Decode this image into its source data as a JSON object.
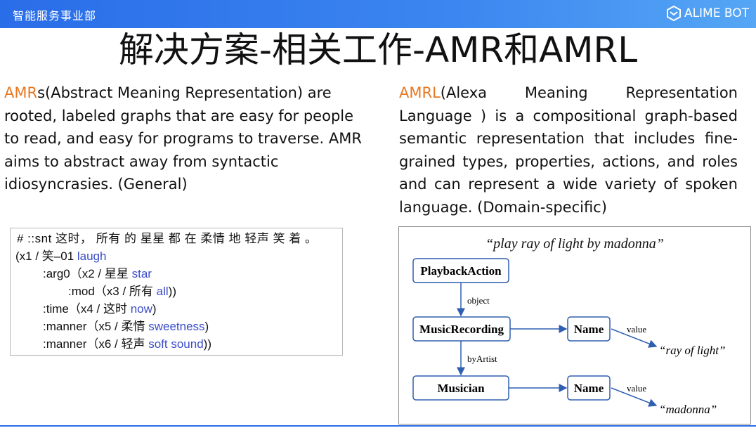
{
  "header": {
    "department": "智能服务事业部",
    "brand": "ALIME BOT"
  },
  "title": "解决方案-相关工作-AMR和AMRL",
  "left": {
    "accent": "AMR",
    "text": "s(Abstract Meaning Representation) are rooted, labeled graphs that are easy for people to read, and easy for programs to traverse. AMR aims to abstract away from syntactic idiosyncrasies. (General)"
  },
  "right": {
    "accent": "AMRL",
    "text": "(Alexa Meaning Representation Language ) is a compositional graph-based semantic representation that includes fine-grained types, properties, actions, and roles and can represent a wide variety of spoken language. (Domain-specific)"
  },
  "amr_example": {
    "lines": [
      {
        "text": "# ::snt 这时， 所有 的 星星 都 在 柔情 地 轻声 笑 着 。",
        "gloss": "",
        "suffix": ""
      },
      {
        "text": "(x1 / 笑–01 ",
        "gloss": "laugh",
        "suffix": ""
      },
      {
        "text": ":arg0（x2 / 星星 ",
        "gloss": "star",
        "suffix": ""
      },
      {
        "text": ":mod（x3 / 所有 ",
        "gloss": "all",
        "suffix": "))"
      },
      {
        "text": ":time（x4 / 这时 ",
        "gloss": "now",
        "suffix": ")"
      },
      {
        "text": ":manner（x5 / 柔情 ",
        "gloss": "sweetness",
        "suffix": ")"
      },
      {
        "text": ":manner（x6 / 轻声 ",
        "gloss": "soft sound",
        "suffix": "))"
      }
    ]
  },
  "amrl_diagram": {
    "caption": "“play ray of light by madonna”",
    "nodes": {
      "playback": "PlaybackAction",
      "music": "MusicRecording",
      "name1": "Name",
      "musician": "Musician",
      "name2": "Name"
    },
    "edges": {
      "object": "object",
      "byArtist": "byArtist",
      "value1": "value",
      "value2": "value"
    },
    "values": {
      "v1": "“ray of light”",
      "v2": "“madonna”"
    }
  },
  "colors": {
    "accent": "#e87722",
    "gloss": "#3a4cc8",
    "header": "#2a6de8",
    "arrow": "#2f5fb0"
  }
}
